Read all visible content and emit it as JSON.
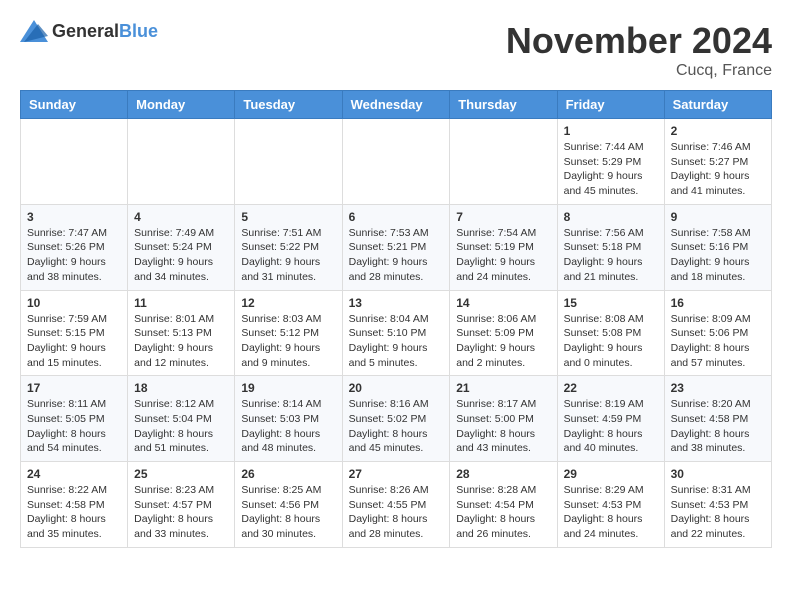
{
  "header": {
    "logo_general": "General",
    "logo_blue": "Blue",
    "month_title": "November 2024",
    "location": "Cucq, France"
  },
  "weekdays": [
    "Sunday",
    "Monday",
    "Tuesday",
    "Wednesday",
    "Thursday",
    "Friday",
    "Saturday"
  ],
  "weeks": [
    [
      {
        "day": "",
        "info": ""
      },
      {
        "day": "",
        "info": ""
      },
      {
        "day": "",
        "info": ""
      },
      {
        "day": "",
        "info": ""
      },
      {
        "day": "",
        "info": ""
      },
      {
        "day": "1",
        "info": "Sunrise: 7:44 AM\nSunset: 5:29 PM\nDaylight: 9 hours and 45 minutes."
      },
      {
        "day": "2",
        "info": "Sunrise: 7:46 AM\nSunset: 5:27 PM\nDaylight: 9 hours and 41 minutes."
      }
    ],
    [
      {
        "day": "3",
        "info": "Sunrise: 7:47 AM\nSunset: 5:26 PM\nDaylight: 9 hours and 38 minutes."
      },
      {
        "day": "4",
        "info": "Sunrise: 7:49 AM\nSunset: 5:24 PM\nDaylight: 9 hours and 34 minutes."
      },
      {
        "day": "5",
        "info": "Sunrise: 7:51 AM\nSunset: 5:22 PM\nDaylight: 9 hours and 31 minutes."
      },
      {
        "day": "6",
        "info": "Sunrise: 7:53 AM\nSunset: 5:21 PM\nDaylight: 9 hours and 28 minutes."
      },
      {
        "day": "7",
        "info": "Sunrise: 7:54 AM\nSunset: 5:19 PM\nDaylight: 9 hours and 24 minutes."
      },
      {
        "day": "8",
        "info": "Sunrise: 7:56 AM\nSunset: 5:18 PM\nDaylight: 9 hours and 21 minutes."
      },
      {
        "day": "9",
        "info": "Sunrise: 7:58 AM\nSunset: 5:16 PM\nDaylight: 9 hours and 18 minutes."
      }
    ],
    [
      {
        "day": "10",
        "info": "Sunrise: 7:59 AM\nSunset: 5:15 PM\nDaylight: 9 hours and 15 minutes."
      },
      {
        "day": "11",
        "info": "Sunrise: 8:01 AM\nSunset: 5:13 PM\nDaylight: 9 hours and 12 minutes."
      },
      {
        "day": "12",
        "info": "Sunrise: 8:03 AM\nSunset: 5:12 PM\nDaylight: 9 hours and 9 minutes."
      },
      {
        "day": "13",
        "info": "Sunrise: 8:04 AM\nSunset: 5:10 PM\nDaylight: 9 hours and 5 minutes."
      },
      {
        "day": "14",
        "info": "Sunrise: 8:06 AM\nSunset: 5:09 PM\nDaylight: 9 hours and 2 minutes."
      },
      {
        "day": "15",
        "info": "Sunrise: 8:08 AM\nSunset: 5:08 PM\nDaylight: 9 hours and 0 minutes."
      },
      {
        "day": "16",
        "info": "Sunrise: 8:09 AM\nSunset: 5:06 PM\nDaylight: 8 hours and 57 minutes."
      }
    ],
    [
      {
        "day": "17",
        "info": "Sunrise: 8:11 AM\nSunset: 5:05 PM\nDaylight: 8 hours and 54 minutes."
      },
      {
        "day": "18",
        "info": "Sunrise: 8:12 AM\nSunset: 5:04 PM\nDaylight: 8 hours and 51 minutes."
      },
      {
        "day": "19",
        "info": "Sunrise: 8:14 AM\nSunset: 5:03 PM\nDaylight: 8 hours and 48 minutes."
      },
      {
        "day": "20",
        "info": "Sunrise: 8:16 AM\nSunset: 5:02 PM\nDaylight: 8 hours and 45 minutes."
      },
      {
        "day": "21",
        "info": "Sunrise: 8:17 AM\nSunset: 5:00 PM\nDaylight: 8 hours and 43 minutes."
      },
      {
        "day": "22",
        "info": "Sunrise: 8:19 AM\nSunset: 4:59 PM\nDaylight: 8 hours and 40 minutes."
      },
      {
        "day": "23",
        "info": "Sunrise: 8:20 AM\nSunset: 4:58 PM\nDaylight: 8 hours and 38 minutes."
      }
    ],
    [
      {
        "day": "24",
        "info": "Sunrise: 8:22 AM\nSunset: 4:58 PM\nDaylight: 8 hours and 35 minutes."
      },
      {
        "day": "25",
        "info": "Sunrise: 8:23 AM\nSunset: 4:57 PM\nDaylight: 8 hours and 33 minutes."
      },
      {
        "day": "26",
        "info": "Sunrise: 8:25 AM\nSunset: 4:56 PM\nDaylight: 8 hours and 30 minutes."
      },
      {
        "day": "27",
        "info": "Sunrise: 8:26 AM\nSunset: 4:55 PM\nDaylight: 8 hours and 28 minutes."
      },
      {
        "day": "28",
        "info": "Sunrise: 8:28 AM\nSunset: 4:54 PM\nDaylight: 8 hours and 26 minutes."
      },
      {
        "day": "29",
        "info": "Sunrise: 8:29 AM\nSunset: 4:53 PM\nDaylight: 8 hours and 24 minutes."
      },
      {
        "day": "30",
        "info": "Sunrise: 8:31 AM\nSunset: 4:53 PM\nDaylight: 8 hours and 22 minutes."
      }
    ]
  ]
}
